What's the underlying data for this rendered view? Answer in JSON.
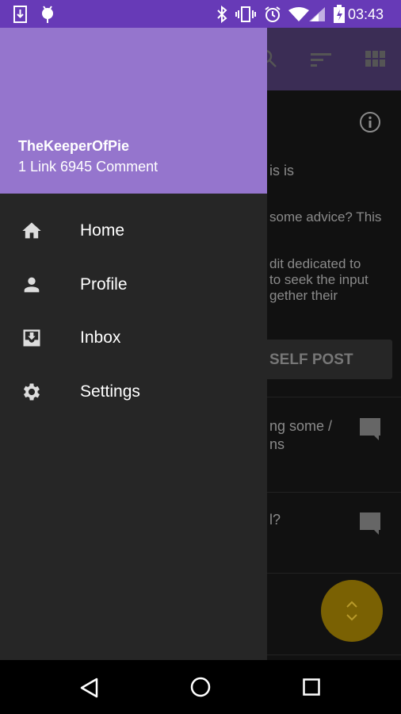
{
  "status_bar": {
    "time": "03:43",
    "icons": [
      "download-icon",
      "android-icon",
      "bluetooth-icon",
      "vibrate-icon",
      "alarm-icon",
      "wifi-icon",
      "signal-icon",
      "battery-charging-icon"
    ]
  },
  "toolbar": {
    "icons": [
      "search-icon",
      "sort-icon",
      "grid-view-icon"
    ]
  },
  "background": {
    "lines": [
      "is is",
      "some advice? This",
      "dit dedicated to",
      "to seek the input",
      "gether their"
    ],
    "self_post_button": "SELF POST",
    "post1": [
      "ng some /",
      "ns"
    ],
    "post2": [
      "l?"
    ]
  },
  "drawer": {
    "username": "TheKeeperOfPie",
    "stats": "1 Link 6945 Comment",
    "header_color": "#9575cd",
    "items": [
      {
        "label": "Home",
        "icon": "home-icon"
      },
      {
        "label": "Profile",
        "icon": "person-icon"
      },
      {
        "label": "Inbox",
        "icon": "inbox-icon"
      },
      {
        "label": "Settings",
        "icon": "gear-icon"
      }
    ]
  },
  "colors": {
    "status_bar": "#673ab7",
    "fab": "#7a6103"
  }
}
